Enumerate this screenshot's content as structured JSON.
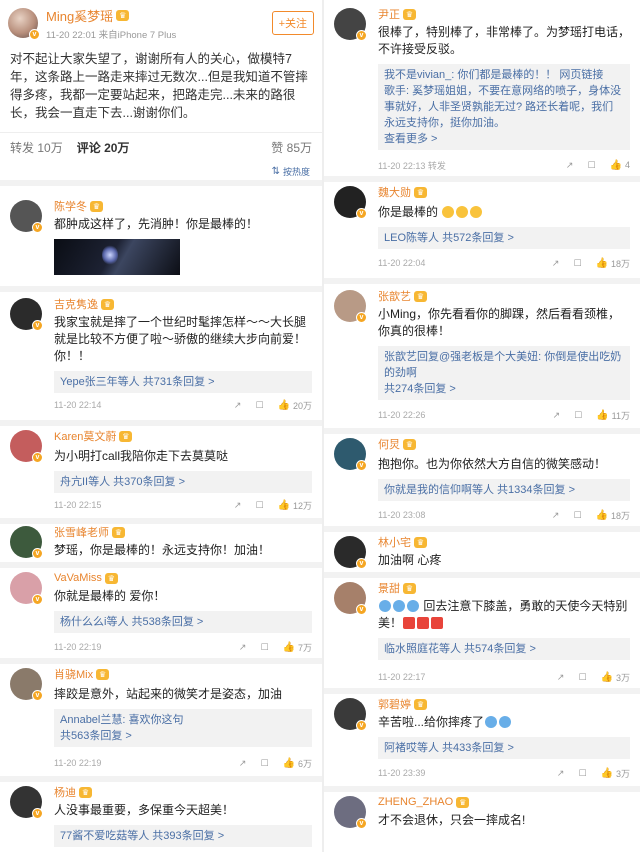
{
  "post": {
    "author": "Ming奚梦瑶",
    "time": "11-20 22:01",
    "source": "来自iPhone 7 Plus",
    "follow_label": "+关注",
    "text": "对不起让大家失望了，谢谢所有人的关心，做模特7年，这条路上一路走来摔过无数次...但是我知道不管摔得多疼，我都一定要站起来，把路走完...未来的路很长，我会一直走下去...谢谢你们。",
    "repost_label": "转发",
    "repost_count": "10万",
    "comment_label": "评论",
    "comment_count": "20万",
    "like_label": "赞",
    "like_count": "85万",
    "sort_label": "按热度",
    "sort_icon": "sort-icon"
  },
  "left_comments": [
    {
      "name": "陈学冬",
      "text": "都肿成这样了，先消肿！你是最棒的！",
      "has_image": true,
      "avatar_color": "#555"
    },
    {
      "name": "吉克隽逸",
      "text": "我家宝就是摔了一个世纪时髦摔怎样～～大长腿就是比较不方便了啦～骄傲的继续大步向前爱！你！！",
      "replies": [
        "Yepe张三年等人 共731条回复 >"
      ],
      "time": "11-20 22:14",
      "likes": "20万",
      "avatar_color": "#2b2b2b"
    },
    {
      "name": "Karen莫文蔚",
      "text": "为小明打call我陪你走下去莫莫哒",
      "replies": [
        "舟亢II等人 共370条回复 >"
      ],
      "time": "11-20 22:15",
      "likes": "12万",
      "avatar_color": "#c45d5d"
    },
    {
      "name": "张雪峰老师",
      "text": "梦瑶，你是最棒的！永远支持你！加油！",
      "avatar_color": "#3d5a3d"
    },
    {
      "name": "VaVaMiss",
      "text": "你就是最棒的 爱你！",
      "replies": [
        "杨什么么i等人 共538条回复 >"
      ],
      "time": "11-20 22:19",
      "likes": "7万",
      "avatar_color": "#d9a0a8"
    },
    {
      "name": "肖骁Mix",
      "text": "摔跤是意外，站起来的微笑才是姿态，加油",
      "replies": [
        "Annabel兰慧: 喜欢你这句",
        "共563条回复 >"
      ],
      "time": "11-20 22:19",
      "likes": "6万",
      "avatar_color": "#8a7a6a"
    },
    {
      "name": "杨迪",
      "text": "人没事最重要，多保重今天超美！",
      "replies": [
        "77酱不爱吃菇等人 共393条回复 >"
      ],
      "avatar_color": "#333"
    }
  ],
  "right_comments": [
    {
      "name": "尹正",
      "text": "很棒了，特别棒了，非常棒了。为梦瑶打电话，不许接受反驳。",
      "replies": [
        "我不是vivian_: 你们都是最棒的！！ 网页链接",
        "歌手: 奚梦瑶姐姐，不要在意网络的喷子，身体没事就好，人非圣贤孰能无过? 路还长着呢，我们永远支持你，挺你加油。",
        "查看更多 >"
      ],
      "time": "11-20 22:13 转发",
      "likes": "4",
      "avatar_color": "#444"
    },
    {
      "name": "魏大勋",
      "text": "你是最棒的",
      "replies": [
        "LEO陈等人 共572条回复 >"
      ],
      "time": "11-20 22:04",
      "likes": "18万",
      "avatar_color": "#222"
    },
    {
      "name": "张歆艺",
      "text": "小Ming，你先看看你的脚踝，然后看看颈椎，你真的很棒！",
      "replies": [
        "张歆艺回复@强老板是个大美妞: 你倒是使出吃奶的劲啊",
        "共274条回复 >"
      ],
      "time": "11-20 22:26",
      "likes": "11万",
      "avatar_color": "#b89a86"
    },
    {
      "name": "何炅",
      "text": "抱抱你。也为你依然大方自信的微笑感动！",
      "replies": [
        "你就是我的信仰啊等人 共1334条回复 >"
      ],
      "time": "11-20 23:08",
      "likes": "18万",
      "avatar_color": "#2e5a6e"
    },
    {
      "name": "林小宅",
      "text": "加油啊 心疼",
      "avatar_color": "#2a2a2a"
    },
    {
      "name": "景甜",
      "text": "回去注意下膝盖，勇敢的天使今天特别美！",
      "replies": [
        "临水照庭花等人 共574条回复 >"
      ],
      "time": "11-20 22:17",
      "likes": "3万",
      "avatar_color": "#a6806a"
    },
    {
      "name": "郭碧婷",
      "text": "辛苦啦...给你摔疼了",
      "replies": [
        "阿褚哎等人 共433条回复 >"
      ],
      "time": "11-20 23:39",
      "likes": "3万",
      "avatar_color": "#3a3a3a"
    },
    {
      "name": "ZHENG_ZHAO",
      "text": "才不会退休，只会一摔成名!",
      "avatar_color": "#6d6d80"
    }
  ]
}
